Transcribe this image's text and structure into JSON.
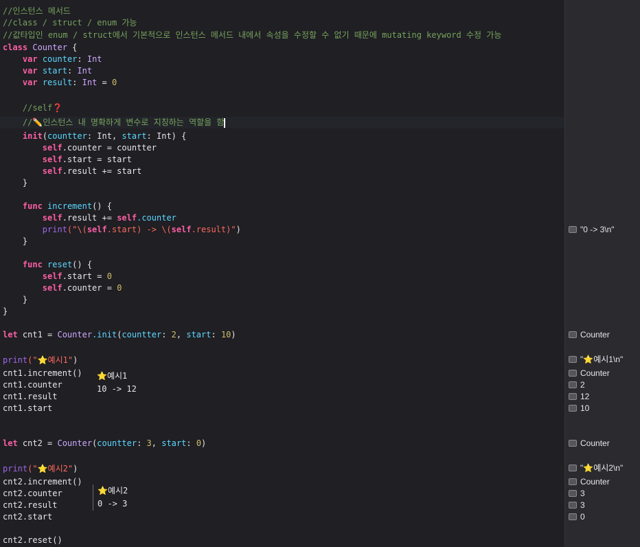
{
  "code": {
    "comment_1": "//인스턴스 메서드",
    "comment_2": "//class / struct / enum 가능",
    "comment_3": "//값타입인 enum / struct에서 기본적으로 인스턴스 메서드 내에서 속성을 수정할 수 없기 때문에 mutating keyword 수정 가능",
    "kw_class": "class",
    "class_name": "Counter",
    "brace_open": " {",
    "kw_var": "var",
    "prop_counter": "counter",
    "prop_start": "start",
    "prop_result": "result",
    "type_int": "Int",
    "colon": ": ",
    "assign": " = ",
    "zero": "0",
    "comment_self": "//self",
    "question_glyph": "❓",
    "comment_prefix": "//",
    "pencil_glyph": "✏️",
    "comment_role": "인스턴스 내 명확하게 변수로 지칭하는 역할을 함",
    "kw_init": "init",
    "param_countter": "countter",
    "param_start": "start",
    "init_sig_mid": ": Int, ",
    "init_sig_end": ": Int) {",
    "kw_self": "self",
    "assign_countter": ".counter = countter",
    "assign_start": ".start = start",
    "plus_result_start": ".result += start",
    "brace_close": "}",
    "kw_func": "func",
    "fn_increment": "increment",
    "fn_reset": "reset",
    "fn_paren": "() {",
    "result_plus": ".result += ",
    "dot_counter": ".counter",
    "fn_print": "print",
    "print_open": "(\"\\(",
    "dot_start_close": ".start) -> \\(",
    "dot_result_close": ".result)\"",
    "close_paren": ")",
    "dot_start_eq": ".start = ",
    "dot_counter_eq": ".counter = ",
    "kw_let": "let",
    "var_cnt1": " cnt1 = ",
    "var_cnt2": " cnt2 = ",
    "dot_init": ".init",
    "paren_open": "(",
    "label_countter": "countter",
    "label_start": "start",
    "comma_space": ", ",
    "colon_space": ": ",
    "num_2": "2",
    "num_10": "10",
    "num_3": "3",
    "num_0": "0",
    "print_ex1_open": "(\"",
    "star_glyph": "⭐",
    "ex1_text": "예시1\"",
    "ex2_text": "예시2\"",
    "cnt1_increment": "cnt1.increment()",
    "cnt1_counter": "cnt1.counter",
    "cnt1_result": "cnt1.result",
    "cnt1_start": "cnt1.start",
    "cnt2_increment": "cnt2.increment()",
    "cnt2_counter": "cnt2.counter",
    "cnt2_result": "cnt2.result",
    "cnt2_start": "cnt2.start",
    "cnt2_reset": "cnt2.reset()"
  },
  "console_output": {
    "ex1_label": "예시1",
    "ex1_line": "10 -> 12",
    "ex2_label": "예시2",
    "ex2_line": "0 -> 3"
  },
  "results": [
    "\"0 -> 3\\n\"",
    "Counter",
    "\"⭐예시1\\n\"",
    "Counter",
    "2",
    "12",
    "10",
    "Counter",
    "\"⭐예시2\\n\"",
    "Counter",
    "3",
    "3",
    "0"
  ],
  "colors": {
    "background": "#1f1f24",
    "results_background": "#2a2a2f",
    "comment": "#77a35c",
    "keyword": "#fc5fa3",
    "type": "#d0a8ff",
    "property": "#5dd8ff",
    "number": "#d0bf69",
    "string": "#fc6a5d"
  }
}
